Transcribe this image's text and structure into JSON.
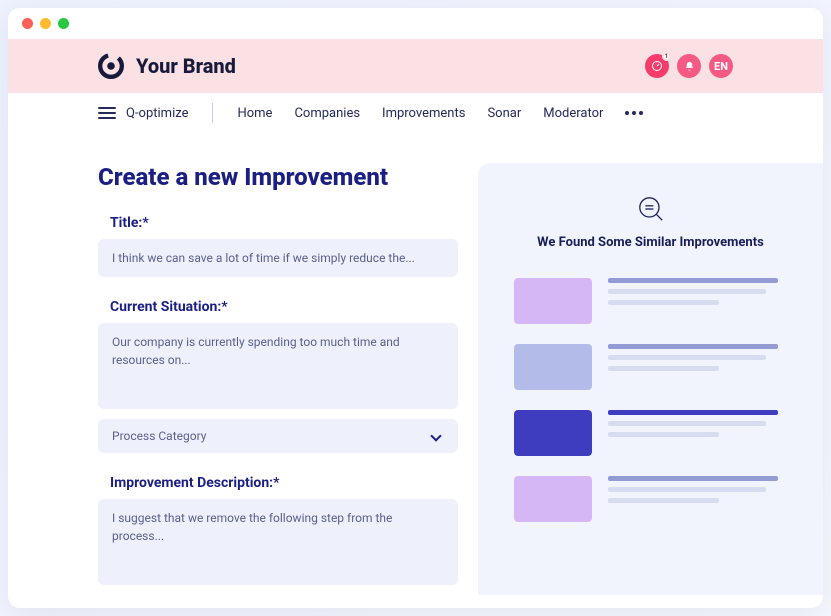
{
  "brand": {
    "name": "Your Brand"
  },
  "header": {
    "locale": "EN",
    "notif_count": "1"
  },
  "nav": {
    "app_name": "Q-optimize",
    "links": [
      "Home",
      "Companies",
      "Improvements",
      "Sonar",
      "Moderator"
    ]
  },
  "page": {
    "title": "Create a new Improvement",
    "fields": {
      "title": {
        "label": "Title:*",
        "placeholder": "I think we can save a lot of time if we simply reduce the..."
      },
      "situation": {
        "label": "Current Situation:*",
        "placeholder": "Our company is currently spending too much time and resources on..."
      },
      "category": {
        "placeholder": "Process Category"
      },
      "description": {
        "label": "Improvement Description:*",
        "placeholder": "I suggest that we remove the following step from the process..."
      }
    }
  },
  "aside": {
    "title": "We Found Some Similar Improvements",
    "results": [
      {
        "thumb_color": "purple",
        "active": false
      },
      {
        "thumb_color": "blue",
        "active": false
      },
      {
        "thumb_color": "darkblue",
        "active": true
      },
      {
        "thumb_color": "purple",
        "active": false
      }
    ]
  }
}
